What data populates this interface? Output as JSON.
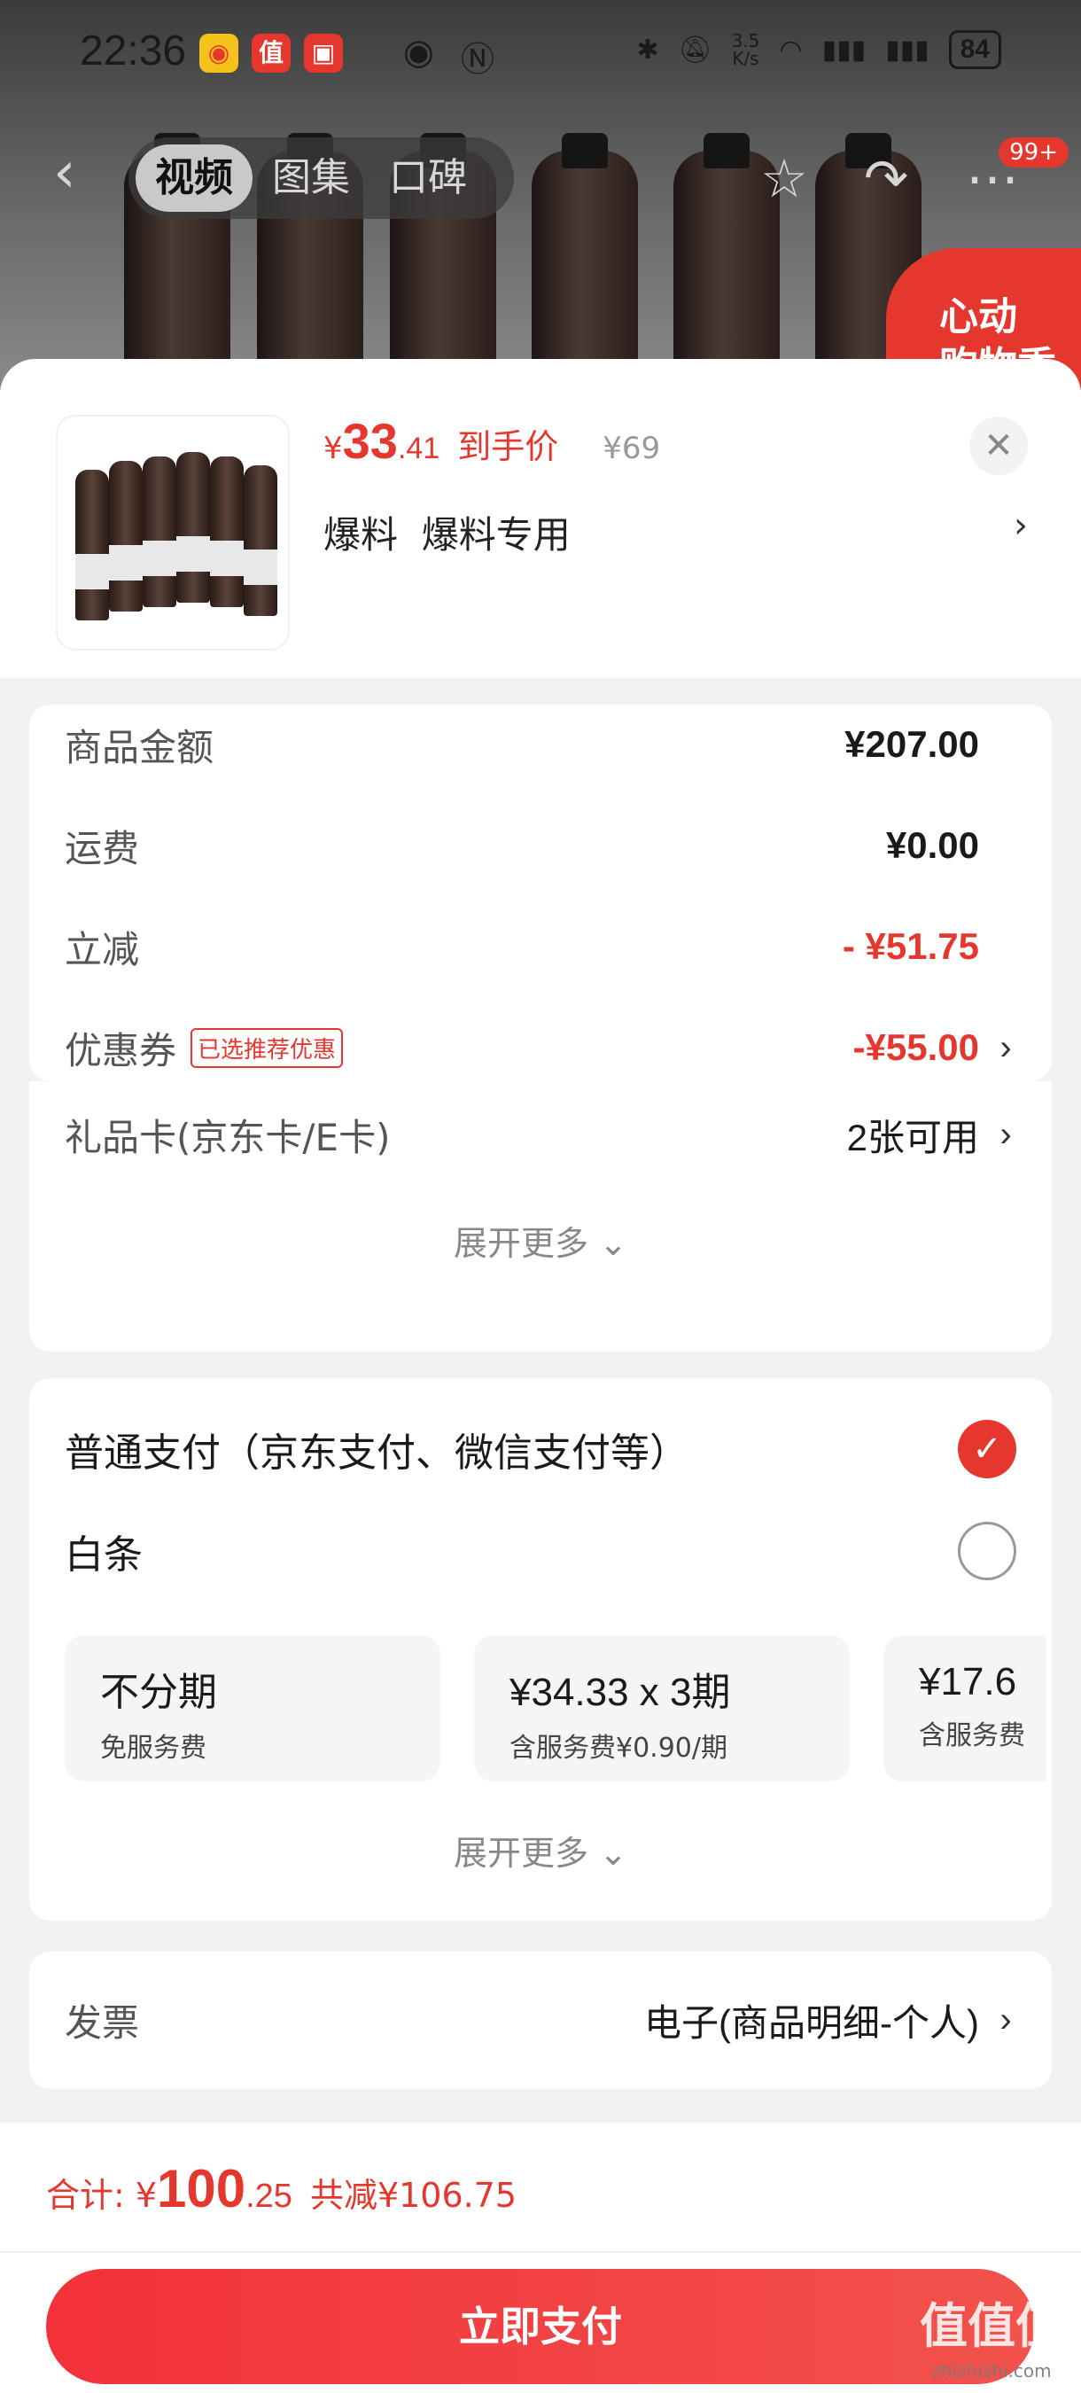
{
  "statusbar": {
    "time": "22:36",
    "net_speed": "3.5\nK/s",
    "battery": "84"
  },
  "nav": {
    "tabs": [
      "视频",
      "图集",
      "口碑"
    ],
    "badge": "99+",
    "promo_text": "心动\n购物季"
  },
  "product": {
    "price_yen": "¥",
    "price_int": "33",
    "price_dec": ".41",
    "price_label": "到手价",
    "original_price": "¥69",
    "spec": "爆料  爆料专用"
  },
  "summary": {
    "rows": [
      {
        "label": "商品金额",
        "value": "¥207.00"
      },
      {
        "label": "运费",
        "value": "¥0.00"
      },
      {
        "label": "立减",
        "value": "- ¥51.75"
      },
      {
        "label": "优惠券",
        "tag": "已选推荐优惠",
        "value": "-¥55.00"
      },
      {
        "label": "礼品卡(京东卡/E卡)",
        "value": "2张可用"
      }
    ],
    "expand": "展开更多"
  },
  "payment": {
    "options": [
      {
        "label": "普通支付（京东支付、微信支付等）",
        "selected": true
      },
      {
        "label": "白条",
        "selected": false
      }
    ],
    "plans": [
      {
        "title": "不分期",
        "sub": "免服务费"
      },
      {
        "title": "¥34.33 x 3期",
        "sub": "含服务费¥0.90/期"
      },
      {
        "title": "¥17.6",
        "sub": "含服务费"
      }
    ],
    "expand": "展开更多"
  },
  "invoice": {
    "label": "发票",
    "value": "电子(商品明细-个人)"
  },
  "footer": {
    "total_label": "合计:",
    "total_yen": "¥",
    "total_int": "100",
    "total_dec": ".25",
    "saved": "共减¥106.75",
    "pay_button": "立即支付"
  },
  "watermark": {
    "text": "值值值",
    "sub": "zhizhizhi.com"
  },
  "colors": {
    "accent": "#e6372f",
    "background": "#f2f2f2"
  }
}
